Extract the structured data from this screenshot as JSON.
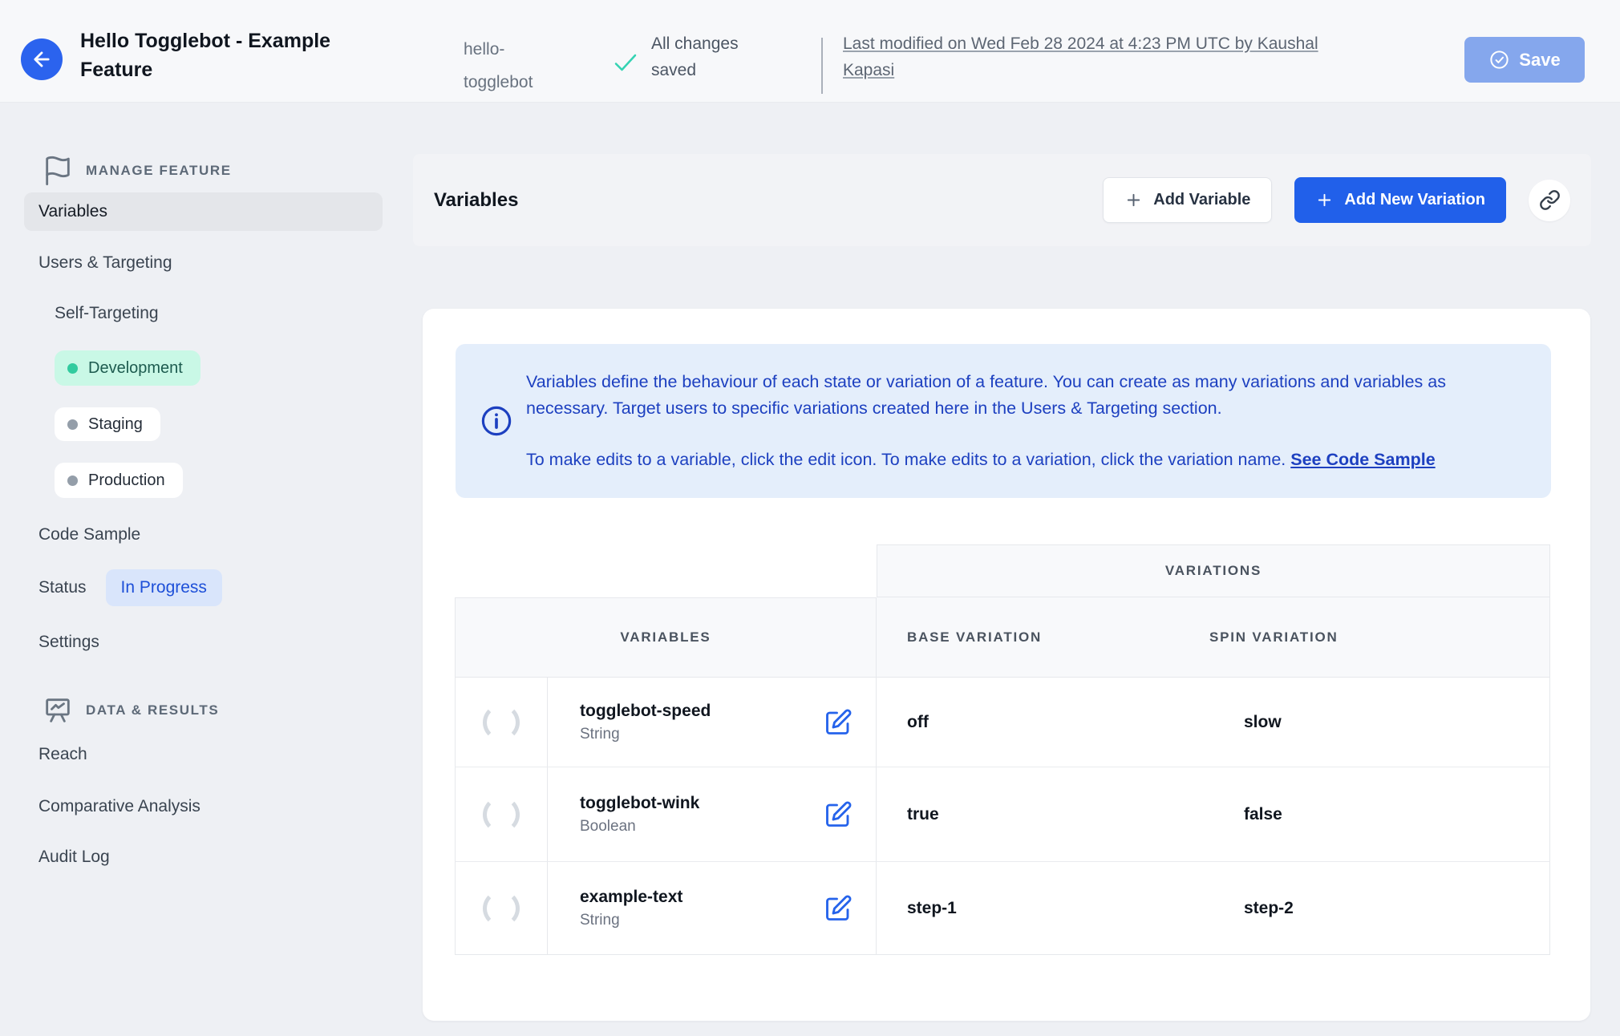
{
  "header": {
    "title": "Hello Togglebot - Example Feature",
    "feature_key": "hello-togglebot",
    "save_status": "All changes saved",
    "last_modified": "Last modified on Wed Feb 28 2024 at 4:23 PM UTC by Kaushal Kapasi",
    "save_label": "Save"
  },
  "sidebar": {
    "manage_feature_label": "MANAGE FEATURE",
    "variables": "Variables",
    "users_targeting": "Users & Targeting",
    "self_targeting": "Self-Targeting",
    "environments": [
      {
        "name": "Development",
        "state": "active"
      },
      {
        "name": "Staging",
        "state": "inactive"
      },
      {
        "name": "Production",
        "state": "inactive"
      }
    ],
    "code_sample": "Code Sample",
    "status_label": "Status",
    "status_badge": "In Progress",
    "settings": "Settings",
    "data_results_label": "DATA & RESULTS",
    "reach": "Reach",
    "comparative_analysis": "Comparative Analysis",
    "audit_log": "Audit Log"
  },
  "toolbar": {
    "title": "Variables",
    "add_variable": "Add Variable",
    "add_new_variation": "Add New Variation"
  },
  "info_box": {
    "paragraph1": "Variables define the behaviour of each state or variation of a feature. You can create as many variations and variables as necessary. Target users to specific variations created here in the Users & Targeting section.",
    "paragraph2_prefix": "To make edits to a variable, click the edit icon. To make edits to a variation, click the variation name. ",
    "link_label": "See Code Sample"
  },
  "table": {
    "group_header": "VARIATIONS",
    "columns": {
      "variables": "VARIABLES",
      "base": "BASE VARIATION",
      "spin": "SPIN VARIATION"
    },
    "rows": [
      {
        "name": "togglebot-speed",
        "type": "String",
        "base": "off",
        "spin": "slow"
      },
      {
        "name": "togglebot-wink",
        "type": "Boolean",
        "base": "true",
        "spin": "false"
      },
      {
        "name": "example-text",
        "type": "String",
        "base": "step-1",
        "spin": "step-2"
      }
    ]
  },
  "colors": {
    "accent_blue": "#2160ea",
    "save_disabled_blue": "#85a7ed",
    "info_bg": "#e4eefb",
    "info_text": "#1d40c0",
    "dev_pill_bg": "#c9f8e6",
    "dev_dot": "#32cb9f",
    "status_badge_bg": "#d9e5fb",
    "status_badge_text": "#1d4fd8",
    "check_teal": "#35d3b3",
    "page_bg": "#eef0f4"
  }
}
